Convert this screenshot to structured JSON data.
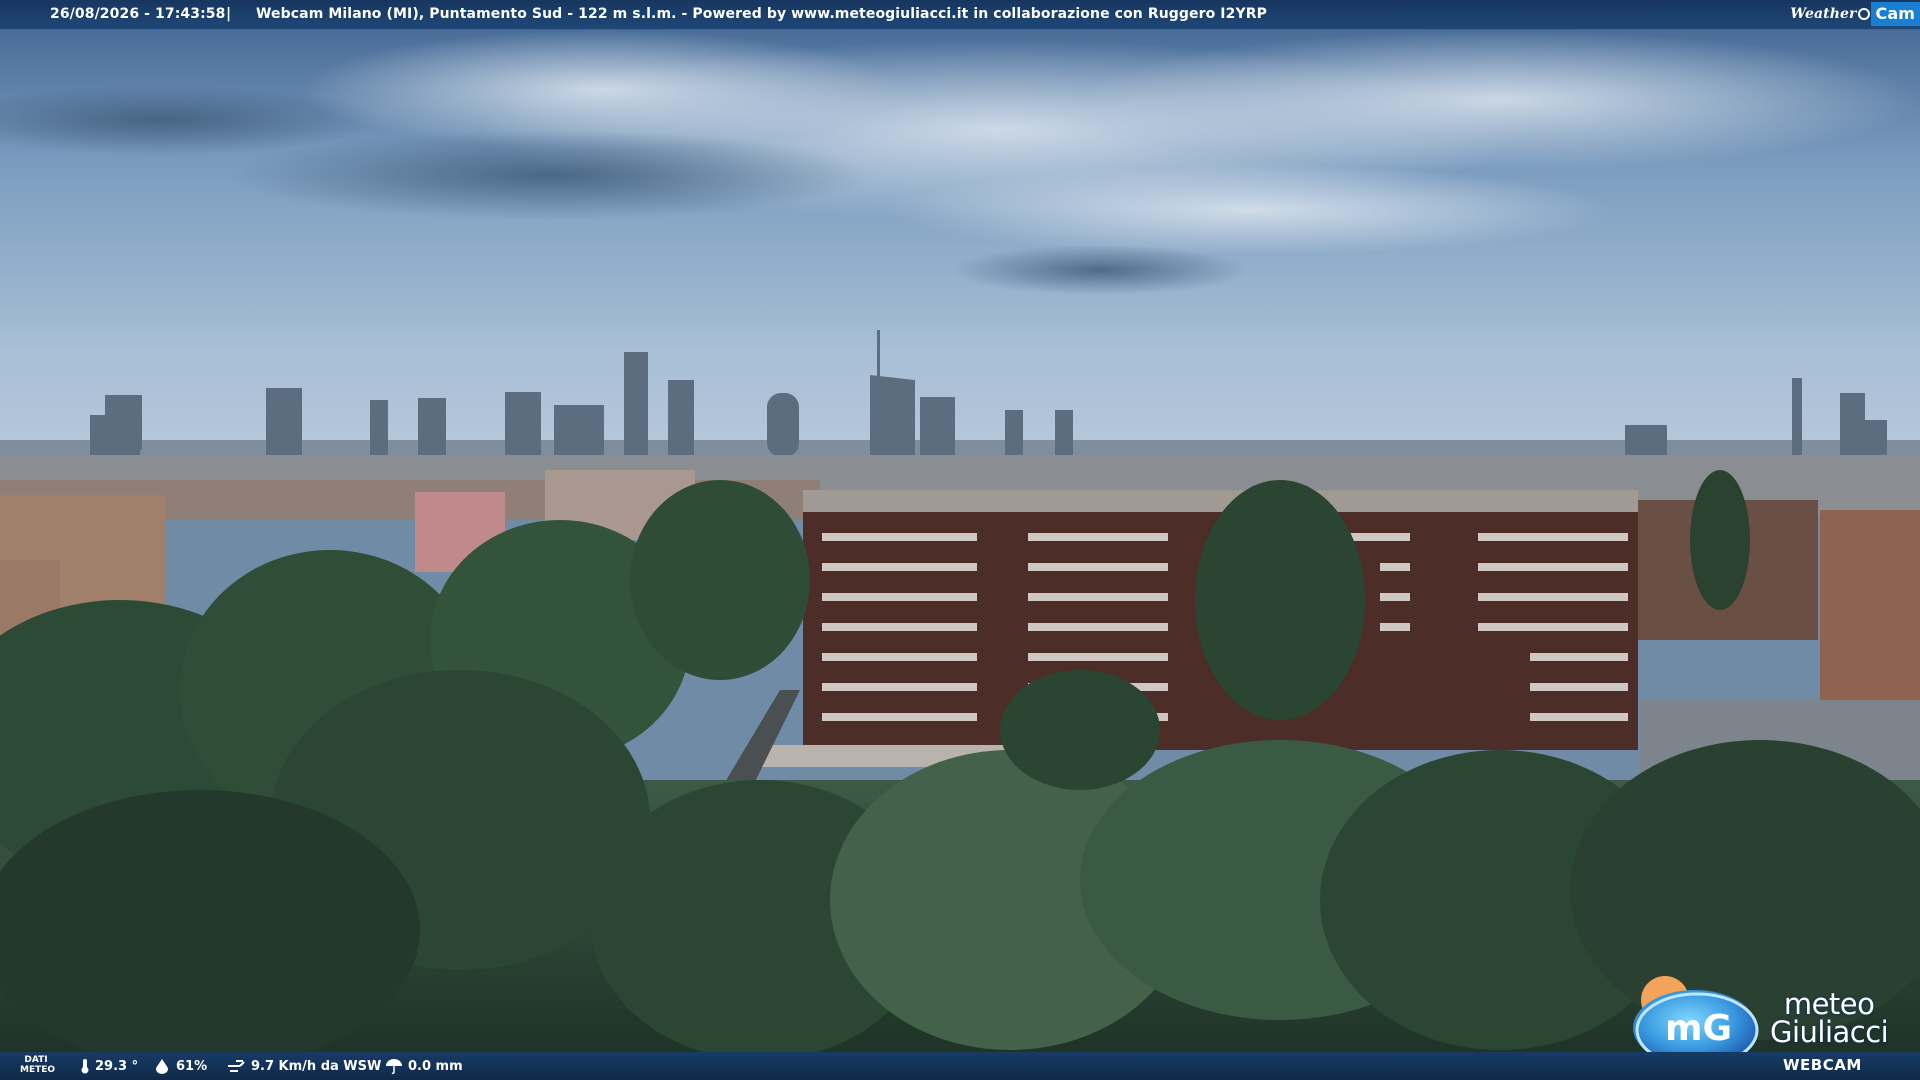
{
  "header": {
    "datetime": "26/08/2026 - 17:43:58",
    "separator": "|",
    "info": "Webcam Milano (MI), Puntamento Sud - 122 m s.l.m. - Powered by www.meteogiuliacci.it in collaborazione con Ruggero I2YRP",
    "logo_word": "Weather",
    "logo_cam": "Cam"
  },
  "footer": {
    "dati_line1": "DATI",
    "dati_line2": "METEO",
    "temperature": "29.3 °",
    "humidity": "61%",
    "wind": "9.7 Km/h da WSW",
    "rain": "0.0 mm"
  },
  "watermark": {
    "line1": "meteo",
    "line2": "Giuliacci",
    "sub": "WEBCAM",
    "badge": "mG"
  },
  "icons": {
    "temperature": "thermometer-icon",
    "humidity": "drop-icon",
    "wind": "wind-icon",
    "rain": "umbrella-icon"
  },
  "colors": {
    "bar": "#173b66",
    "logo_blue": "#1a7fd0"
  }
}
